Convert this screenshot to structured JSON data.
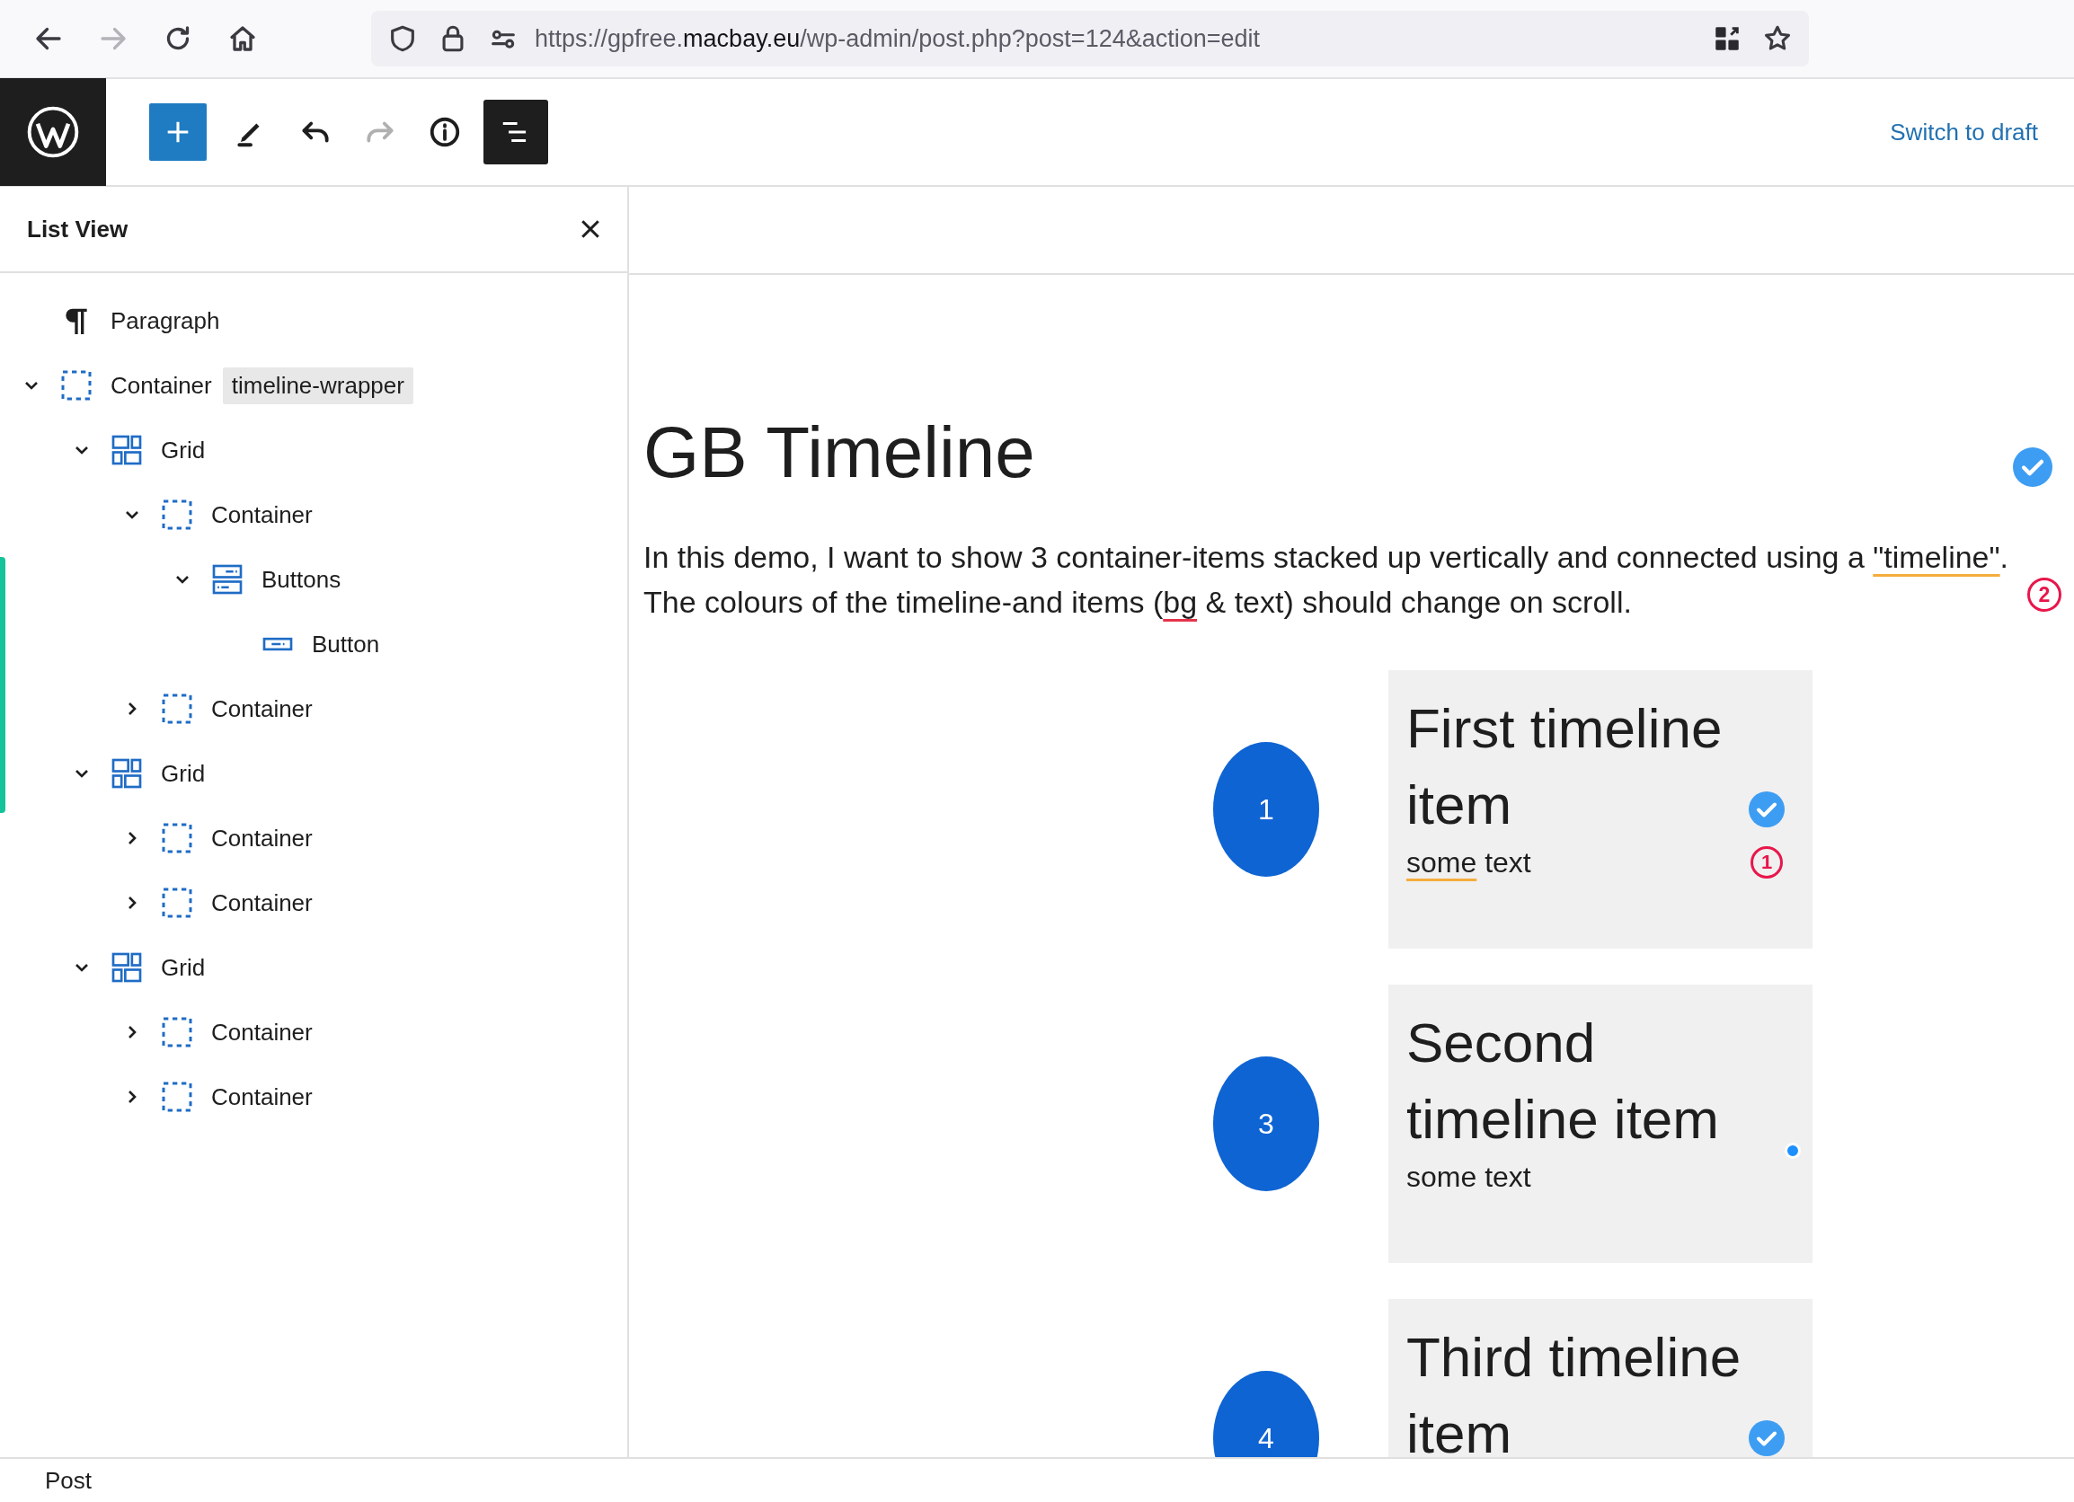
{
  "browser": {
    "url": {
      "prefix": "https://gpfree.",
      "domain": "macbay.eu",
      "path": "/wp-admin/post.php?post=124&action=edit"
    },
    "forward_disabled": true
  },
  "toolbar": {
    "redo_disabled": true,
    "list_view_active": true,
    "switch_to_draft": "Switch to draft"
  },
  "list_view": {
    "title": "List View",
    "items": [
      {
        "label": "Paragraph",
        "kind": "paragraph"
      },
      {
        "label": "Container",
        "kind": "container",
        "tag": "timeline-wrapper",
        "expanded": true,
        "children": [
          {
            "label": "Grid",
            "kind": "grid",
            "expanded": true,
            "children": [
              {
                "label": "Container",
                "kind": "container",
                "expanded": true,
                "children": [
                  {
                    "label": "Buttons",
                    "kind": "buttons",
                    "expanded": true,
                    "children": [
                      {
                        "label": "Button",
                        "kind": "button"
                      }
                    ]
                  }
                ]
              },
              {
                "label": "Container",
                "kind": "container",
                "expanded": false
              }
            ]
          },
          {
            "label": "Grid",
            "kind": "grid",
            "expanded": true,
            "children": [
              {
                "label": "Container",
                "kind": "container",
                "expanded": false
              },
              {
                "label": "Container",
                "kind": "container",
                "expanded": false
              }
            ]
          },
          {
            "label": "Grid",
            "kind": "grid",
            "expanded": true,
            "children": [
              {
                "label": "Container",
                "kind": "container",
                "expanded": false
              },
              {
                "label": "Container",
                "kind": "container",
                "expanded": false
              }
            ]
          }
        ]
      }
    ]
  },
  "editor": {
    "title": "GB Timeline",
    "title_indicator": {
      "kind": "check"
    },
    "paragraph": {
      "segments": [
        {
          "text": "In this demo, I want to show 3 container-items stacked up vertically and connected using a "
        },
        {
          "text": "\"timeline\"",
          "kind": "style"
        },
        {
          "text": ". The colours of the timeline-and items ("
        },
        {
          "text": "bg",
          "kind": "spelling"
        },
        {
          "text": " & text) should change on scroll."
        }
      ],
      "badge": "2"
    },
    "timeline": [
      {
        "number": "1",
        "title": "First timeline item",
        "text": [
          {
            "text": "some",
            "kind": "style"
          },
          {
            "text": " text"
          }
        ],
        "indicator": {
          "kind": "check"
        },
        "badge": "1"
      },
      {
        "number": "3",
        "title": "Second timeline item",
        "text": [
          {
            "text": "some text"
          }
        ],
        "indicator": {
          "kind": "dot"
        }
      },
      {
        "number": "4",
        "title": "Third timeline item",
        "indicator": {
          "kind": "check"
        }
      }
    ]
  },
  "footer": {
    "breadcrumb": "Post"
  }
}
